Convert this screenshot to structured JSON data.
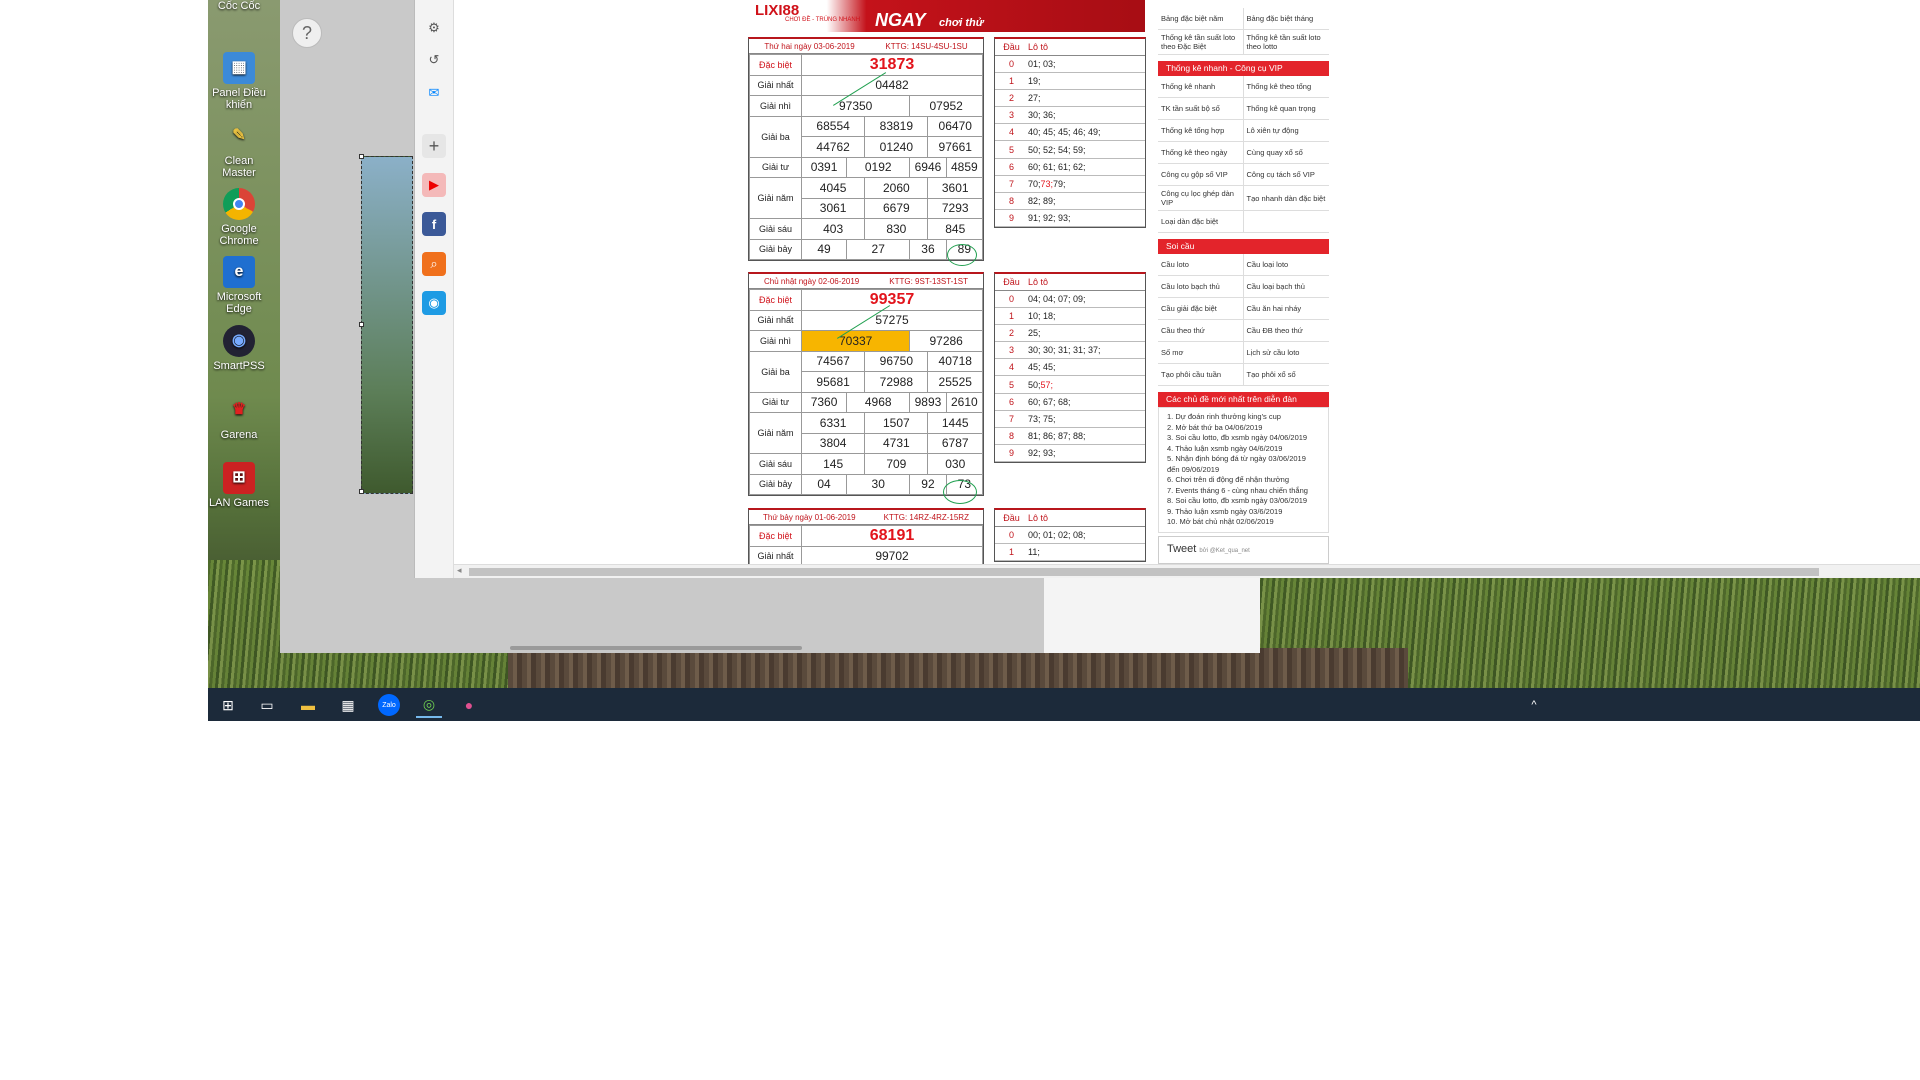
{
  "desktop_icons": [
    {
      "label": "Cốc Cốc",
      "icon": "coccoc-icon"
    },
    {
      "label": "Panel Điều khiển",
      "icon": "control-panel-icon"
    },
    {
      "label": "Clean Master",
      "icon": "clean-master-icon"
    },
    {
      "label": "Google Chrome",
      "icon": "chrome-icon"
    },
    {
      "label": "Microsoft Edge",
      "icon": "edge-icon"
    },
    {
      "label": "SmartPSS",
      "icon": "smartpss-icon"
    },
    {
      "label": "Garena",
      "icon": "garena-icon"
    },
    {
      "label": "LAN Games",
      "icon": "lan-games-icon"
    }
  ],
  "help_symbol": "?",
  "banner": {
    "logo": "LIXI88",
    "sub": "CHƠI ĐỀ - TRÚNG NHANH",
    "ngay": "NGAY",
    "choi": "chơi thử"
  },
  "results": [
    {
      "date": "Thứ hai ngày 03-06-2019",
      "kttg": "KTTG: 14SU-4SU-1SU",
      "db": "31873",
      "g1": "04482",
      "g2": [
        "97350",
        "07952"
      ],
      "g3": [
        "68554",
        "83819",
        "06470",
        "44762",
        "01240",
        "97661"
      ],
      "g4": [
        "0391",
        "0192",
        "6946",
        "4859"
      ],
      "g5": [
        "4045",
        "2060",
        "3601",
        "3061",
        "6679",
        "7293"
      ],
      "g6": [
        "403",
        "830",
        "845"
      ],
      "g7": [
        "49",
        "27",
        "36",
        "89"
      ],
      "loto_header": [
        "Đầu",
        "Lô tô"
      ],
      "loto": [
        {
          "d": "0",
          "v": "01; 03;"
        },
        {
          "d": "1",
          "v": "19;"
        },
        {
          "d": "2",
          "v": "27;"
        },
        {
          "d": "3",
          "v": "30; 36;"
        },
        {
          "d": "4",
          "v": "40; 45; 45; 46; 49;"
        },
        {
          "d": "5",
          "v": "50; 52; 54; 59;"
        },
        {
          "d": "6",
          "v": "60; 61; 61; 62;"
        },
        {
          "d": "7",
          "v": "70; ",
          "hi": "73;",
          "v2": " 79;"
        },
        {
          "d": "8",
          "v": "82; 89;"
        },
        {
          "d": "9",
          "v": "91; 92; 93;"
        }
      ]
    },
    {
      "date": "Chủ nhật ngày 02-06-2019",
      "kttg": "KTTG: 9ST-13ST-1ST",
      "db": "99357",
      "g1": "57275",
      "g2": [
        "70337",
        "97286"
      ],
      "g3": [
        "74567",
        "96750",
        "40718",
        "95681",
        "72988",
        "25525"
      ],
      "g4": [
        "7360",
        "4968",
        "9893",
        "2610"
      ],
      "g5": [
        "6331",
        "1507",
        "1445",
        "3804",
        "4731",
        "6787"
      ],
      "g6": [
        "145",
        "709",
        "030"
      ],
      "g7": [
        "04",
        "30",
        "92",
        "73"
      ],
      "loto_header": [
        "Đầu",
        "Lô tô"
      ],
      "loto": [
        {
          "d": "0",
          "v": "04; 04; 07; 09;"
        },
        {
          "d": "1",
          "v": "10; 18;"
        },
        {
          "d": "2",
          "v": "25;"
        },
        {
          "d": "3",
          "v": "30; 30; 31; 31; 37;"
        },
        {
          "d": "4",
          "v": "45; 45;"
        },
        {
          "d": "5",
          "v": "50; ",
          "hi": "57;",
          "v2": ""
        },
        {
          "d": "6",
          "v": "60; 67; 68;"
        },
        {
          "d": "7",
          "v": "73; 75;"
        },
        {
          "d": "8",
          "v": "81; 86; 87; 88;"
        },
        {
          "d": "9",
          "v": "92; 93;"
        }
      ]
    },
    {
      "date": "Thứ bảy ngày 01-06-2019",
      "kttg": "KTTG: 14RZ-4RZ-15RZ",
      "db": "68191",
      "g1": "99702",
      "loto_header": [
        "Đầu",
        "Lô tô"
      ],
      "loto": [
        {
          "d": "0",
          "v": "00; 01; 02; 08;"
        },
        {
          "d": "1",
          "v": "11;"
        }
      ]
    }
  ],
  "labels": {
    "db": "Đặc biệt",
    "g1": "Giải nhất",
    "g2": "Giải nhì",
    "g3": "Giải ba",
    "g4": "Giải tư",
    "g5": "Giải năm",
    "g6": "Giải sáu",
    "g7": "Giải bảy"
  },
  "right_sidebar": {
    "top_links": [
      "Bảng đặc biệt năm",
      "Bảng đặc biệt tháng",
      "Thống kê tần suất loto theo Đặc Biệt",
      "Thống kê tần suất loto theo lotto"
    ],
    "quick_title": "Thống kê nhanh - Công cụ VIP",
    "quick": [
      "Thống kê nhanh",
      "Thống kê theo tổng",
      "TK tần suất bộ số",
      "Thống kê quan trọng",
      "Thống kê tổng hợp",
      "Lô xiên tự động",
      "Thống kê theo ngày",
      "Cùng quay xổ số",
      "Công cụ gộp số VIP",
      "Công cụ tách số VIP",
      "Công cụ lọc ghép dàn VIP",
      "Tạo nhanh dàn đặc biệt",
      "Loại dàn đặc biệt",
      ""
    ],
    "soi_title": "Soi cầu",
    "soi": [
      "Cầu loto",
      "Cầu loại loto",
      "Cầu loto bạch thủ",
      "Cầu loại bạch thủ",
      "Cầu giải đặc biệt",
      "Cầu ăn hai nháy",
      "Cầu theo thứ",
      "Cầu ĐB theo thứ",
      "Số mơ",
      "Lịch sử cầu loto",
      "Tạo phôi cầu tuần",
      "Tạo phôi xổ số"
    ],
    "forum_title": "Các chủ đề mới nhất trên diễn đàn",
    "forum": [
      "1. Dự đoán rinh thưởng king's cup",
      "2. Mở bát thứ ba 04/06/2019",
      "3. Soi cầu lotto, đb xsmb ngày 04/06/2019",
      "4. Thảo luận xsmb ngày 04/6/2019",
      "5. Nhận định bóng đá từ ngày 03/06/2019 đến 09/06/2019",
      "6. Chơi trên di động để nhận thưởng",
      "7. Events tháng 6 - cùng nhau chiến thắng",
      "8. Soi cầu lotto, đb xsmb ngày 03/06/2019",
      "9. Thảo luận xsmb ngày 03/6/2019",
      "10. Mở bát chủ nhật 02/06/2019"
    ],
    "tweet": "Tweet",
    "tweet_by": "bởi @Ket_qua_net"
  },
  "taskbar": [
    "windows-start-icon",
    "task-view-icon",
    "file-explorer-icon",
    "store-icon",
    "zalo-icon",
    "coccoc-taskbar-icon",
    "maps-icon"
  ],
  "taskbar_zalo": "Zalo"
}
